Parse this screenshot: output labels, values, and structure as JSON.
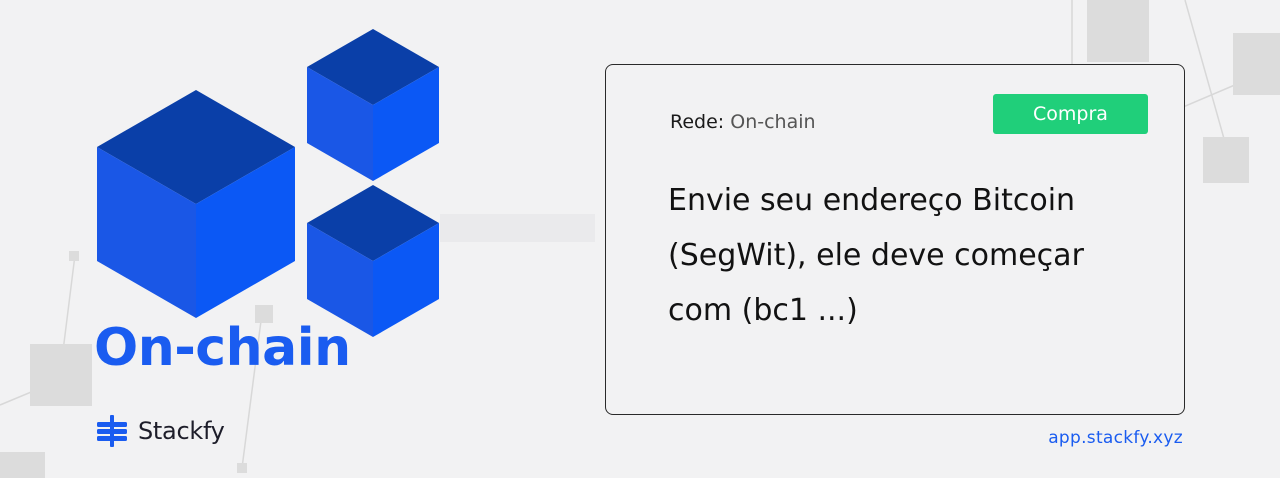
{
  "banner": {
    "title": "On-chain",
    "brand_name": "Stackfy",
    "url": "app.stackfy.xyz"
  },
  "card": {
    "network_label": "Rede:",
    "network_value": "On-chain",
    "badge": "Compra",
    "message_lines": [
      "Envie seu endereço Bitcoin",
      "(SegWit), ele deve começar",
      "com (bc1 ...)"
    ]
  },
  "icons": [
    "cube-icon",
    "stackfy-logo-icon"
  ],
  "colors": {
    "background": "#f2f2f3",
    "accent_blue": "#1a5cf0",
    "badge_green": "#20cf7a",
    "text_dark": "#121212"
  }
}
